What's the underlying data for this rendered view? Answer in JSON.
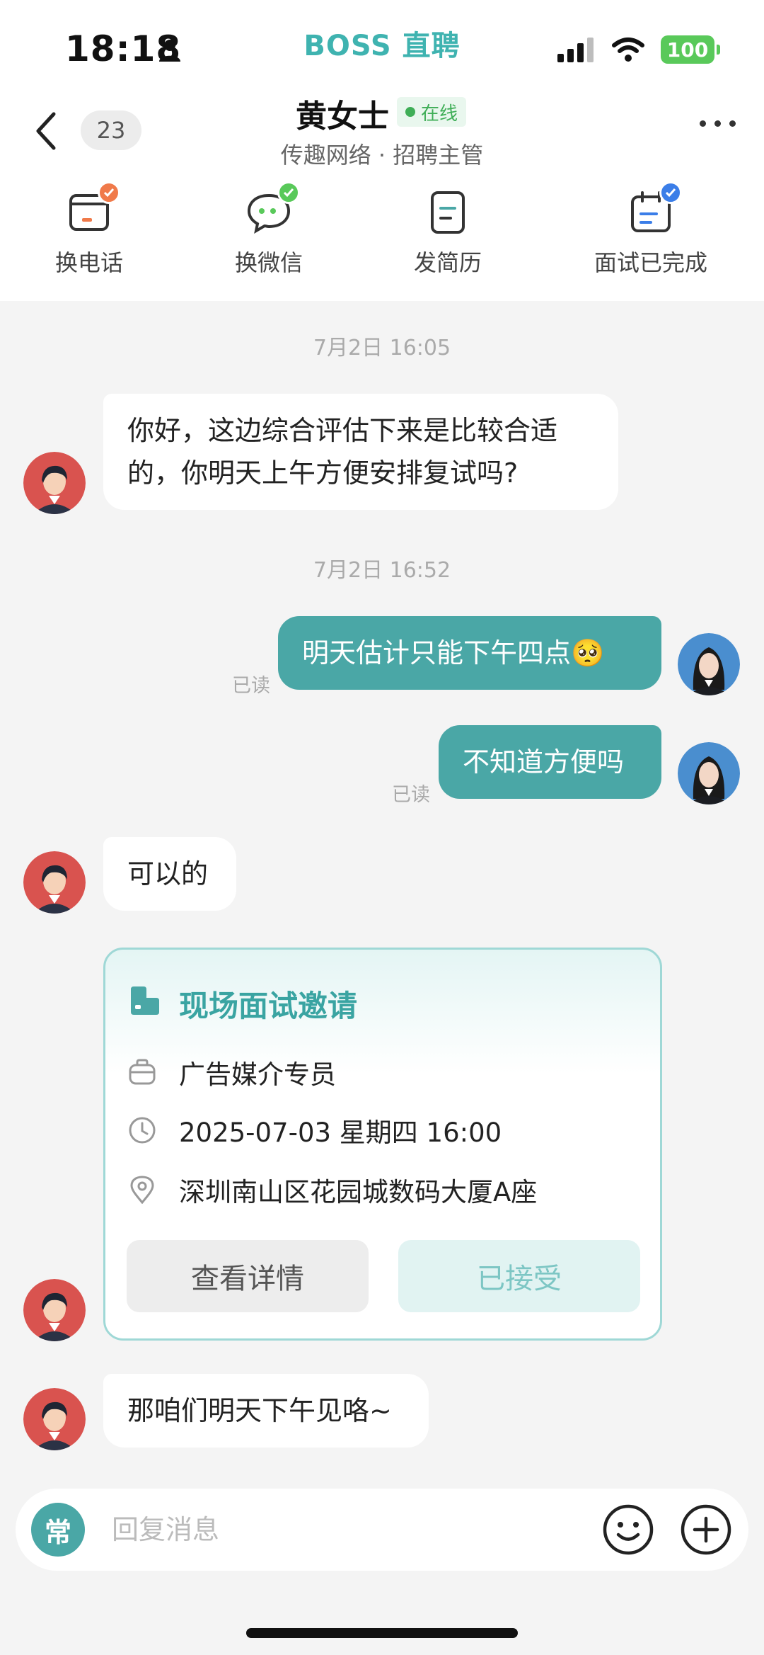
{
  "status_bar": {
    "time": "18:18",
    "app_brand": "BOSS 直聘",
    "battery": "100"
  },
  "header": {
    "unread_count": "23",
    "contact_name": "黄女士",
    "online_label": "在线",
    "contact_subtitle": "传趣网络 · 招聘主管"
  },
  "actions": [
    {
      "label": "换电话",
      "icon": "phone-swap-icon",
      "badge_color": "#f07a4a"
    },
    {
      "label": "换微信",
      "icon": "wechat-swap-icon",
      "badge_color": "#59c95a"
    },
    {
      "label": "发简历",
      "icon": "resume-icon"
    },
    {
      "label": "面试已完成",
      "icon": "interview-done-icon",
      "badge_color": "#3b7ee8"
    }
  ],
  "chat": {
    "time_1": "7月2日 16:05",
    "msg_1": "你好，这边综合评估下来是比较合适的，你明天上午方便安排复试吗?",
    "time_2": "7月2日 16:52",
    "msg_2": "明天估计只能下午四点",
    "msg_2_emoji": "🥺",
    "msg_2_status": "已读",
    "msg_3": "不知道方便吗",
    "msg_3_status": "已读",
    "msg_4": "可以的",
    "msg_5": "那咱们明天下午见咯~"
  },
  "invitation": {
    "title": "现场面试邀请",
    "position": "广告媒介专员",
    "datetime": "2025-07-03 星期四 16:00",
    "location": "深圳南山区花园城数码大厦A座",
    "detail_button": "查看详情",
    "accepted_button": "已接受"
  },
  "input_bar": {
    "common_label": "常",
    "placeholder": "回复消息"
  },
  "colors": {
    "accent": "#4aa7a6",
    "brand": "#3fb3b0",
    "online": "#3fae57"
  }
}
